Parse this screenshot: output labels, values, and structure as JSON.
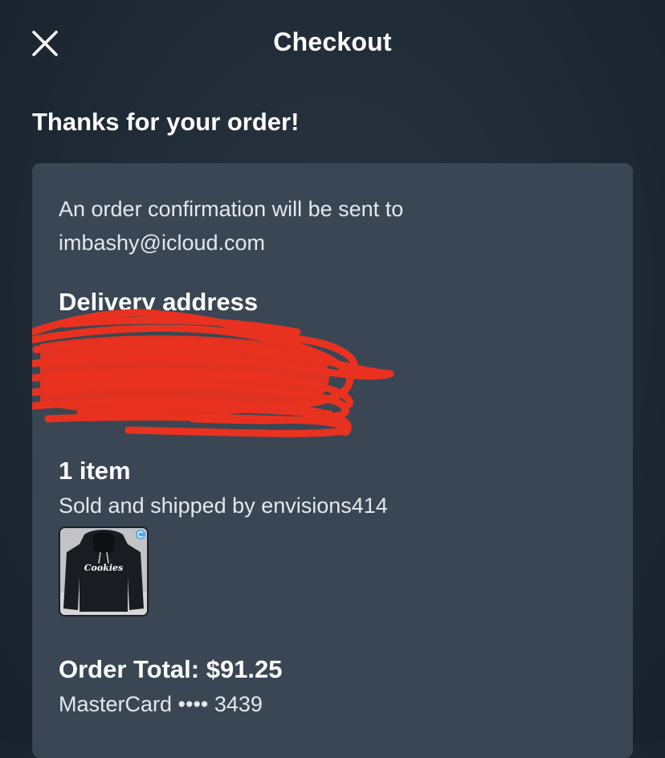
{
  "header": {
    "title": "Checkout",
    "close_icon": "close-icon"
  },
  "thanks_message": "Thanks for your order!",
  "confirmation": {
    "text": "An order confirmation will be sent to imbashy@icloud.com"
  },
  "delivery": {
    "title": "Delivery address",
    "redacted": true,
    "redaction_color": "#e8321f"
  },
  "items": {
    "title": "1 item",
    "seller_text": "Sold and shipped by envisions414",
    "thumbnail": {
      "product_label": "Cookies",
      "badge_icon": "cookies-badge-icon"
    }
  },
  "order": {
    "total_label": "Order Total: $91.25",
    "payment_label": "MasterCard •••• 3439"
  },
  "colors": {
    "background": "#1f2a36",
    "card": "#3a4654",
    "text_primary": "#ffffff",
    "text_secondary": "#e4e8ec"
  }
}
